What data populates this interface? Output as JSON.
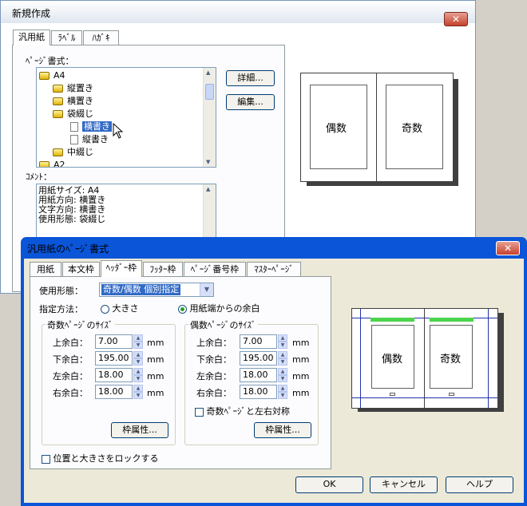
{
  "new_window": {
    "title": "新規作成",
    "close_glyph": "✕",
    "tabs": [
      "汎用紙",
      "ﾗﾍﾞﾙ",
      "ﾊｶﾞｷ"
    ],
    "page_format_label": "ﾍﾟｰｼﾞ書式：",
    "tree": [
      {
        "label": "A4",
        "icon": "folder-icon"
      },
      {
        "label": "縦置き",
        "icon": "folder-icon"
      },
      {
        "label": "横置き",
        "icon": "folder-icon"
      },
      {
        "label": "袋綴じ",
        "icon": "folder-icon"
      },
      {
        "label": "横書き",
        "icon": "document-icon",
        "selected": true
      },
      {
        "label": "縦書き",
        "icon": "document-icon"
      },
      {
        "label": "中綴じ",
        "icon": "folder-icon"
      },
      {
        "label": "A2",
        "icon": "folder-icon"
      }
    ],
    "detail_button": "詳細...",
    "edit_button": "編集...",
    "comment_label": "ｺﾒﾝﾄ：",
    "comment_lines": [
      "用紙サイズ: A4",
      "用紙方向: 横置き",
      "文字方向: 横書き",
      "使用形態: 袋綴じ"
    ],
    "preview": {
      "left": "偶数",
      "right": "奇数"
    }
  },
  "page_window": {
    "title": "汎用紙のﾍﾟｰｼﾞ書式",
    "close_glyph": "✕",
    "tabs": [
      "用紙",
      "本文枠",
      "ﾍｯﾀﾞｰ枠",
      "ﾌｯﾀｰ枠",
      "ﾍﾟｰｼﾞ番号枠",
      "ﾏｽﾀｰﾍﾟｰｼﾞ"
    ],
    "active_tab": 2,
    "usage_label": "使用形態：",
    "usage_value": "奇数/偶数 個別指定",
    "method_label": "指定方法：",
    "method_options": [
      "大きさ",
      "用紙端からの余白"
    ],
    "method_selected": 1,
    "odd_group": {
      "title": "奇数ﾍﾟｰｼﾞのｻｲｽﾞ",
      "rows": [
        {
          "label": "上余白：",
          "value": "7.00",
          "unit": "mm"
        },
        {
          "label": "下余白：",
          "value": "195.00",
          "unit": "mm"
        },
        {
          "label": "左余白：",
          "value": "18.00",
          "unit": "mm"
        },
        {
          "label": "右余白：",
          "value": "18.00",
          "unit": "mm"
        }
      ],
      "button": "枠属性..."
    },
    "even_group": {
      "title": "偶数ﾍﾟｰｼﾞのｻｲｽﾞ",
      "rows": [
        {
          "label": "上余白：",
          "value": "7.00",
          "unit": "mm"
        },
        {
          "label": "下余白：",
          "value": "195.00",
          "unit": "mm"
        },
        {
          "label": "左余白：",
          "value": "18.00",
          "unit": "mm"
        },
        {
          "label": "右余白：",
          "value": "18.00",
          "unit": "mm"
        }
      ],
      "symmetric_label": "奇数ﾍﾟｰｼﾞと左右対称",
      "button": "枠属性..."
    },
    "lock_label": "位置と大きさをロックする",
    "preview": {
      "left": "偶数",
      "right": "奇数"
    },
    "ok_button": "OK",
    "cancel_button": "キャンセル",
    "help_button": "ヘルプ"
  },
  "colors": {
    "titlebar_active": "#0a55d8",
    "selection": "#316ac5",
    "header_bar": "#4cd44c",
    "frame_line": "#2233aa"
  }
}
